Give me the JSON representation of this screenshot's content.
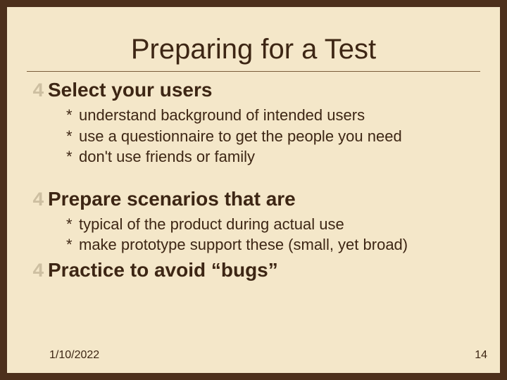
{
  "title": "Preparing for a Test",
  "sections": [
    {
      "heading": "Select your users",
      "subs": [
        "understand background of intended users",
        "use a questionnaire to get the people you need",
        "don't use friends or family"
      ]
    },
    {
      "heading": "Prepare scenarios that are",
      "subs": [
        "typical of the product during actual use",
        "make prototype support these (small, yet broad)"
      ]
    },
    {
      "heading": "Practice to avoid “bugs”",
      "subs": []
    }
  ],
  "footer": {
    "date": "1/10/2022",
    "page": "14"
  }
}
